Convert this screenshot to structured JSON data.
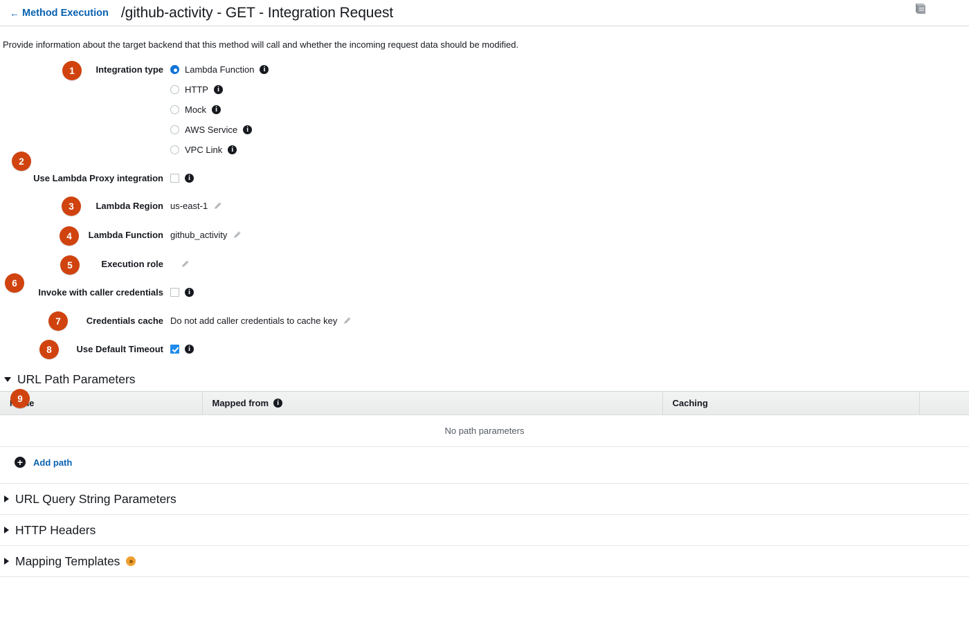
{
  "header": {
    "back_link": "Method Execution",
    "back_arrow": "←",
    "title": "/github-activity - GET - Integration Request",
    "doc_icon": "book-icon"
  },
  "intro": "Provide information about the target backend that this method will call and whether the incoming request data should be modified.",
  "form": {
    "integration_type": {
      "badge": "1",
      "label": "Integration type",
      "options": [
        {
          "label": "Lambda Function",
          "selected": true
        },
        {
          "label": "HTTP",
          "selected": false
        },
        {
          "label": "Mock",
          "selected": false
        },
        {
          "label": "AWS Service",
          "selected": false
        },
        {
          "label": "VPC Link",
          "selected": false
        }
      ]
    },
    "lambda_proxy": {
      "badge": "2",
      "label": "Use Lambda Proxy integration",
      "checked": false
    },
    "lambda_region": {
      "badge": "3",
      "label": "Lambda Region",
      "value": "us-east-1"
    },
    "lambda_function": {
      "badge": "4",
      "label": "Lambda Function",
      "value": "github_activity"
    },
    "execution_role": {
      "badge": "5",
      "label": "Execution role",
      "value": ""
    },
    "caller_credentials": {
      "badge": "6",
      "label": "Invoke with caller credentials",
      "checked": false
    },
    "credentials_cache": {
      "badge": "7",
      "label": "Credentials cache",
      "value": "Do not add caller credentials to cache key"
    },
    "default_timeout": {
      "badge": "8",
      "label": "Use Default Timeout",
      "checked": true
    }
  },
  "url_path_parameters": {
    "badge": "9",
    "title": "URL Path Parameters",
    "expanded": true,
    "columns": [
      "Name",
      "Mapped from",
      "Caching",
      ""
    ],
    "empty_message": "No path parameters",
    "add_label": "Add path",
    "add_icon": "plus-circle-icon"
  },
  "sections": [
    {
      "title": "URL Query String Parameters",
      "expanded": false,
      "badge_dot": false
    },
    {
      "title": "HTTP Headers",
      "expanded": false,
      "badge_dot": false
    },
    {
      "title": "Mapping Templates",
      "expanded": false,
      "badge_dot": true
    }
  ],
  "colors": {
    "badge": "#d0430f",
    "link": "#0a62b0",
    "radio_selected": "#0f73d5",
    "checkbox_checked": "#1f8ceb",
    "dot_badge": "#f0a132"
  }
}
